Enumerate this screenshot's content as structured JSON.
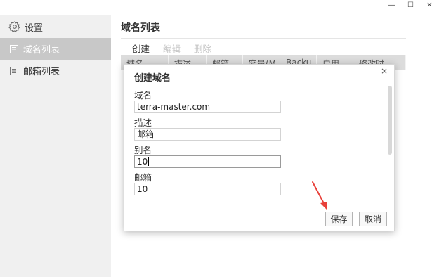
{
  "window_controls": {
    "minimize": "—",
    "maximize": "☐",
    "close": "✕"
  },
  "sidebar": {
    "header": {
      "label": "设置",
      "icon": "gear-icon"
    },
    "items": [
      {
        "label": "域名列表",
        "icon": "list-icon",
        "active": true
      },
      {
        "label": "邮箱列表",
        "icon": "list-icon",
        "active": false
      }
    ]
  },
  "main": {
    "title": "域名列表",
    "toolbar": {
      "create": "创建",
      "edit": "编辑",
      "delete": "删除"
    },
    "table": {
      "columns": [
        "域名",
        "描述",
        "邮箱",
        "容量(M",
        "Backu",
        "启用",
        "修改时"
      ]
    }
  },
  "dialog": {
    "title": "创建域名",
    "close": "×",
    "fields": [
      {
        "label": "域名",
        "value": "terra-master.com"
      },
      {
        "label": "描述",
        "value": "邮箱"
      },
      {
        "label": "别名",
        "value": "10"
      },
      {
        "label": "邮箱",
        "value": "10"
      }
    ],
    "save": "保存",
    "cancel": "取消"
  },
  "annotation": {
    "arrow_color": "#e8413b"
  }
}
